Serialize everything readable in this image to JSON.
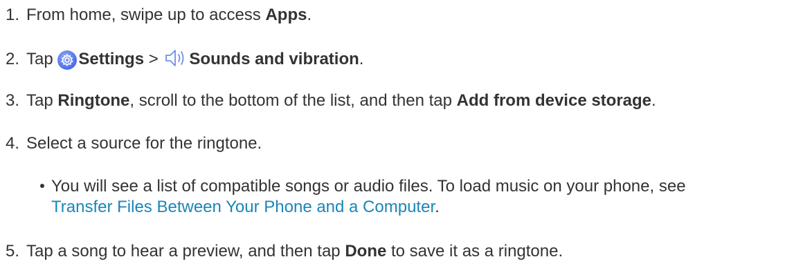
{
  "steps": [
    {
      "number": "1.",
      "text_before": "From home, swipe up to access ",
      "bold": "Apps",
      "text_after": "."
    },
    {
      "number": "2.",
      "text_tap": "Tap",
      "settings_icon": "settings-gear-icon",
      "settings_label": "Settings",
      "separator": ">",
      "sound_icon": "speaker-icon",
      "sounds_label": "Sounds and vibration",
      "text_after": "."
    },
    {
      "number": "3.",
      "text_tap": "Tap ",
      "ringtone_label": "Ringtone",
      "text_middle": ", scroll to the bottom of the list, and then tap ",
      "add_label": "Add from device storage",
      "text_after": "."
    },
    {
      "number": "4.",
      "text": "Select a source for the ringtone."
    },
    {
      "number": "5.",
      "text_before": "Tap a song to hear a preview, and then tap ",
      "done_label": "Done",
      "text_after": " to save it as a ringtone."
    }
  ],
  "bullet": {
    "line1": "You will see a list of compatible songs or audio files. To load music on your phone, see",
    "link_text": "Transfer Files Between Your Phone and a Computer",
    "line2_after": "."
  },
  "colors": {
    "text": "#333333",
    "link": "#1b86b8",
    "icon_blue": "#4a6ee8"
  }
}
